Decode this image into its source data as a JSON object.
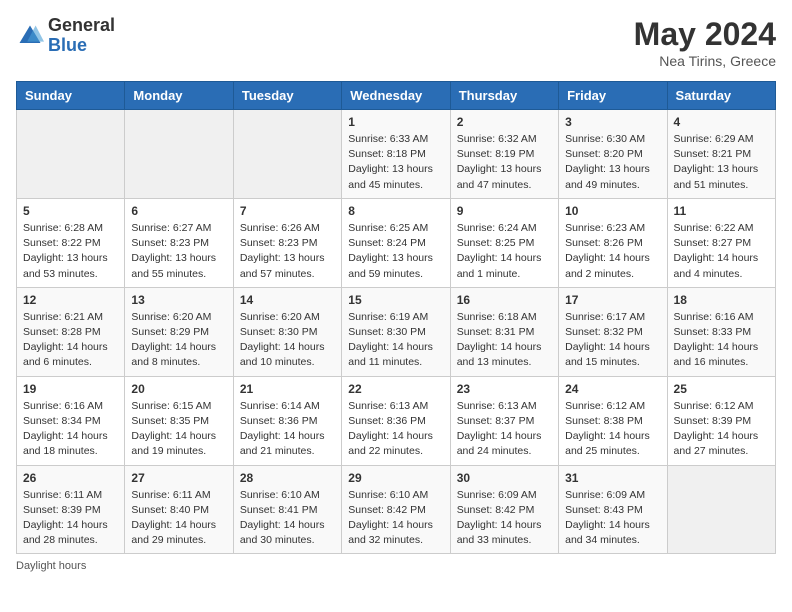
{
  "header": {
    "logo_general": "General",
    "logo_blue": "Blue",
    "month": "May 2024",
    "location": "Nea Tirins, Greece"
  },
  "weekdays": [
    "Sunday",
    "Monday",
    "Tuesday",
    "Wednesday",
    "Thursday",
    "Friday",
    "Saturday"
  ],
  "weeks": [
    [
      {
        "day": "",
        "info": ""
      },
      {
        "day": "",
        "info": ""
      },
      {
        "day": "",
        "info": ""
      },
      {
        "day": "1",
        "info": "Sunrise: 6:33 AM\nSunset: 8:18 PM\nDaylight: 13 hours\nand 45 minutes."
      },
      {
        "day": "2",
        "info": "Sunrise: 6:32 AM\nSunset: 8:19 PM\nDaylight: 13 hours\nand 47 minutes."
      },
      {
        "day": "3",
        "info": "Sunrise: 6:30 AM\nSunset: 8:20 PM\nDaylight: 13 hours\nand 49 minutes."
      },
      {
        "day": "4",
        "info": "Sunrise: 6:29 AM\nSunset: 8:21 PM\nDaylight: 13 hours\nand 51 minutes."
      }
    ],
    [
      {
        "day": "5",
        "info": "Sunrise: 6:28 AM\nSunset: 8:22 PM\nDaylight: 13 hours\nand 53 minutes."
      },
      {
        "day": "6",
        "info": "Sunrise: 6:27 AM\nSunset: 8:23 PM\nDaylight: 13 hours\nand 55 minutes."
      },
      {
        "day": "7",
        "info": "Sunrise: 6:26 AM\nSunset: 8:23 PM\nDaylight: 13 hours\nand 57 minutes."
      },
      {
        "day": "8",
        "info": "Sunrise: 6:25 AM\nSunset: 8:24 PM\nDaylight: 13 hours\nand 59 minutes."
      },
      {
        "day": "9",
        "info": "Sunrise: 6:24 AM\nSunset: 8:25 PM\nDaylight: 14 hours\nand 1 minute."
      },
      {
        "day": "10",
        "info": "Sunrise: 6:23 AM\nSunset: 8:26 PM\nDaylight: 14 hours\nand 2 minutes."
      },
      {
        "day": "11",
        "info": "Sunrise: 6:22 AM\nSunset: 8:27 PM\nDaylight: 14 hours\nand 4 minutes."
      }
    ],
    [
      {
        "day": "12",
        "info": "Sunrise: 6:21 AM\nSunset: 8:28 PM\nDaylight: 14 hours\nand 6 minutes."
      },
      {
        "day": "13",
        "info": "Sunrise: 6:20 AM\nSunset: 8:29 PM\nDaylight: 14 hours\nand 8 minutes."
      },
      {
        "day": "14",
        "info": "Sunrise: 6:20 AM\nSunset: 8:30 PM\nDaylight: 14 hours\nand 10 minutes."
      },
      {
        "day": "15",
        "info": "Sunrise: 6:19 AM\nSunset: 8:30 PM\nDaylight: 14 hours\nand 11 minutes."
      },
      {
        "day": "16",
        "info": "Sunrise: 6:18 AM\nSunset: 8:31 PM\nDaylight: 14 hours\nand 13 minutes."
      },
      {
        "day": "17",
        "info": "Sunrise: 6:17 AM\nSunset: 8:32 PM\nDaylight: 14 hours\nand 15 minutes."
      },
      {
        "day": "18",
        "info": "Sunrise: 6:16 AM\nSunset: 8:33 PM\nDaylight: 14 hours\nand 16 minutes."
      }
    ],
    [
      {
        "day": "19",
        "info": "Sunrise: 6:16 AM\nSunset: 8:34 PM\nDaylight: 14 hours\nand 18 minutes."
      },
      {
        "day": "20",
        "info": "Sunrise: 6:15 AM\nSunset: 8:35 PM\nDaylight: 14 hours\nand 19 minutes."
      },
      {
        "day": "21",
        "info": "Sunrise: 6:14 AM\nSunset: 8:36 PM\nDaylight: 14 hours\nand 21 minutes."
      },
      {
        "day": "22",
        "info": "Sunrise: 6:13 AM\nSunset: 8:36 PM\nDaylight: 14 hours\nand 22 minutes."
      },
      {
        "day": "23",
        "info": "Sunrise: 6:13 AM\nSunset: 8:37 PM\nDaylight: 14 hours\nand 24 minutes."
      },
      {
        "day": "24",
        "info": "Sunrise: 6:12 AM\nSunset: 8:38 PM\nDaylight: 14 hours\nand 25 minutes."
      },
      {
        "day": "25",
        "info": "Sunrise: 6:12 AM\nSunset: 8:39 PM\nDaylight: 14 hours\nand 27 minutes."
      }
    ],
    [
      {
        "day": "26",
        "info": "Sunrise: 6:11 AM\nSunset: 8:39 PM\nDaylight: 14 hours\nand 28 minutes."
      },
      {
        "day": "27",
        "info": "Sunrise: 6:11 AM\nSunset: 8:40 PM\nDaylight: 14 hours\nand 29 minutes."
      },
      {
        "day": "28",
        "info": "Sunrise: 6:10 AM\nSunset: 8:41 PM\nDaylight: 14 hours\nand 30 minutes."
      },
      {
        "day": "29",
        "info": "Sunrise: 6:10 AM\nSunset: 8:42 PM\nDaylight: 14 hours\nand 32 minutes."
      },
      {
        "day": "30",
        "info": "Sunrise: 6:09 AM\nSunset: 8:42 PM\nDaylight: 14 hours\nand 33 minutes."
      },
      {
        "day": "31",
        "info": "Sunrise: 6:09 AM\nSunset: 8:43 PM\nDaylight: 14 hours\nand 34 minutes."
      },
      {
        "day": "",
        "info": ""
      }
    ]
  ],
  "footer": "Daylight hours"
}
